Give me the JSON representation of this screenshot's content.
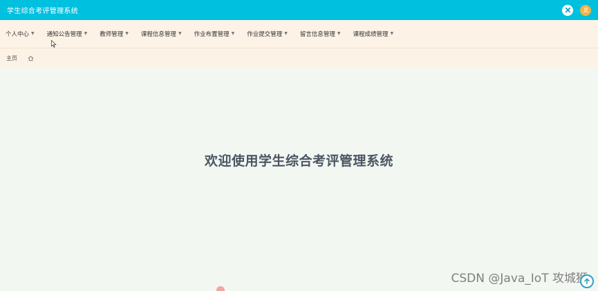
{
  "header": {
    "app_title": "学生综合考评管理系统"
  },
  "nav": {
    "items": [
      {
        "label": "个人中心"
      },
      {
        "label": "通知公告管理"
      },
      {
        "label": "教师管理"
      },
      {
        "label": "课程信息管理"
      },
      {
        "label": "作业布置管理"
      },
      {
        "label": "作业提交管理"
      },
      {
        "label": "留言信息管理"
      },
      {
        "label": "课程成绩管理"
      }
    ]
  },
  "breadcrumb": {
    "home_label": "主页"
  },
  "main": {
    "welcome": "欢迎使用学生综合考评管理系统"
  },
  "watermark": "CSDN @Java_IoT 攻城狮",
  "colors": {
    "header_bg": "#00c0e0",
    "nav_bg": "#fdf2e6",
    "content_bg": "#f3f7f2",
    "user_avatar": "#f3b347"
  }
}
